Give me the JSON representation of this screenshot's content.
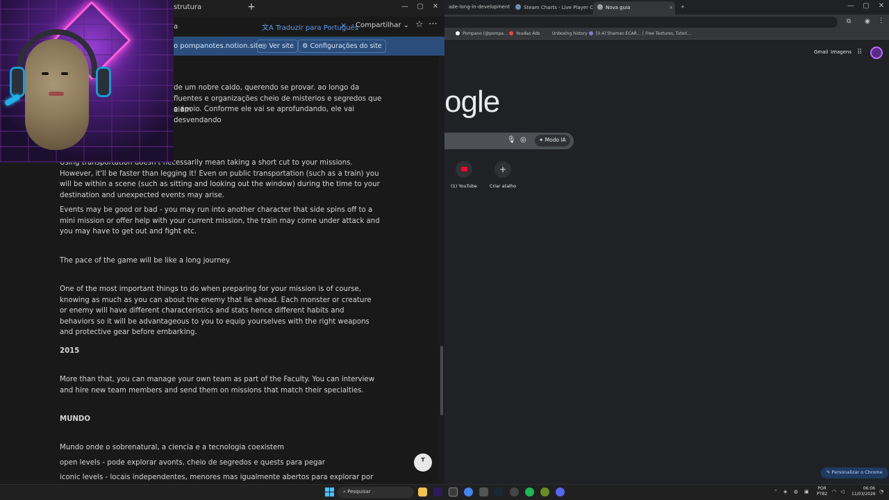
{
  "notion": {
    "tab_label": "strutura",
    "crumb": "a",
    "translate_label": "Traduzir para Português",
    "share_label": "Compartilhar",
    "site_url": "o pompanotes.notion.site",
    "view_site": "Ver site",
    "site_settings": "Configurações do site",
    "paragraphs": [
      "de um nobre caido, querendo se provar. ao longo da",
      "fluentes e organizações cheio de misterios e segredos que além",
      "o apoio. Conforme ele vai se aprofundando, ele vai desvendando",
      "Using transportation doesn't necessarily mean taking a short cut to your missions. However, it'll be faster than legging it! Even on public transportation (such as a train) you will be within a scene (such as sitting and looking out the window) during the time to your destination and unexpected events may arise.",
      "Events may be good or bad - you may run into another character that side spins off to a mini mission or offer help with your current mission, the train may come under attack and you may have to get out and fight etc.",
      "The pace of the game will be like a long journey.",
      "One of the most important things to do when preparing for your mission is of course, knowing as much as you can about the enemy that lie ahead. Each monster or creature or enemy will have different characteristics and stats hence different habits and behaviors so it will be advantageous to you to equip yourselves with the right weapons and protective gear before embarking.",
      "2015",
      "More than that, you can manage your own team as part of the Faculty. You can interview and hire new team members and send them on missions that match their specialties.",
      "MUNDO",
      "Mundo onde o sobrenatural, a ciencia e a tecnologia coexistem",
      "open levels - pode explorar avonts, cheio de segredos e quests para pegar",
      "iconic levels - locais independentes, menores mas igualmente abertos para explorar por novos"
    ]
  },
  "chrome": {
    "tabs": [
      "ade-long-in-development",
      "Steam Charts - Live Player Cou",
      "Nova guia"
    ],
    "bookmarks": [
      "Pompano (@pompa...",
      "Youdao Ads",
      "Unboxing history",
      "[0.4] Shaman ECAR...",
      "Free Textures, Tutori..."
    ],
    "gmail": "Gmail",
    "images": "Imagens",
    "logo_text": "ogle",
    "modo_ia": "Modo IA",
    "shortcuts": [
      {
        "label": "(1) YouTube",
        "icon": "youtube-icon"
      },
      {
        "label": "Criar atalho",
        "icon": "plus-icon"
      }
    ],
    "customize": "Personalizar o Chrome"
  },
  "taskbar": {
    "search_placeholder": "Pesquisar",
    "lang_line1": "POR",
    "lang_line2": "PTB2",
    "time": "06:06",
    "date": "11/03/2026"
  },
  "colors": {
    "notion_bg": "#191919",
    "banner": "#2a4d7c",
    "link_blue": "#5a9ff2",
    "chrome_bg": "#202124"
  }
}
